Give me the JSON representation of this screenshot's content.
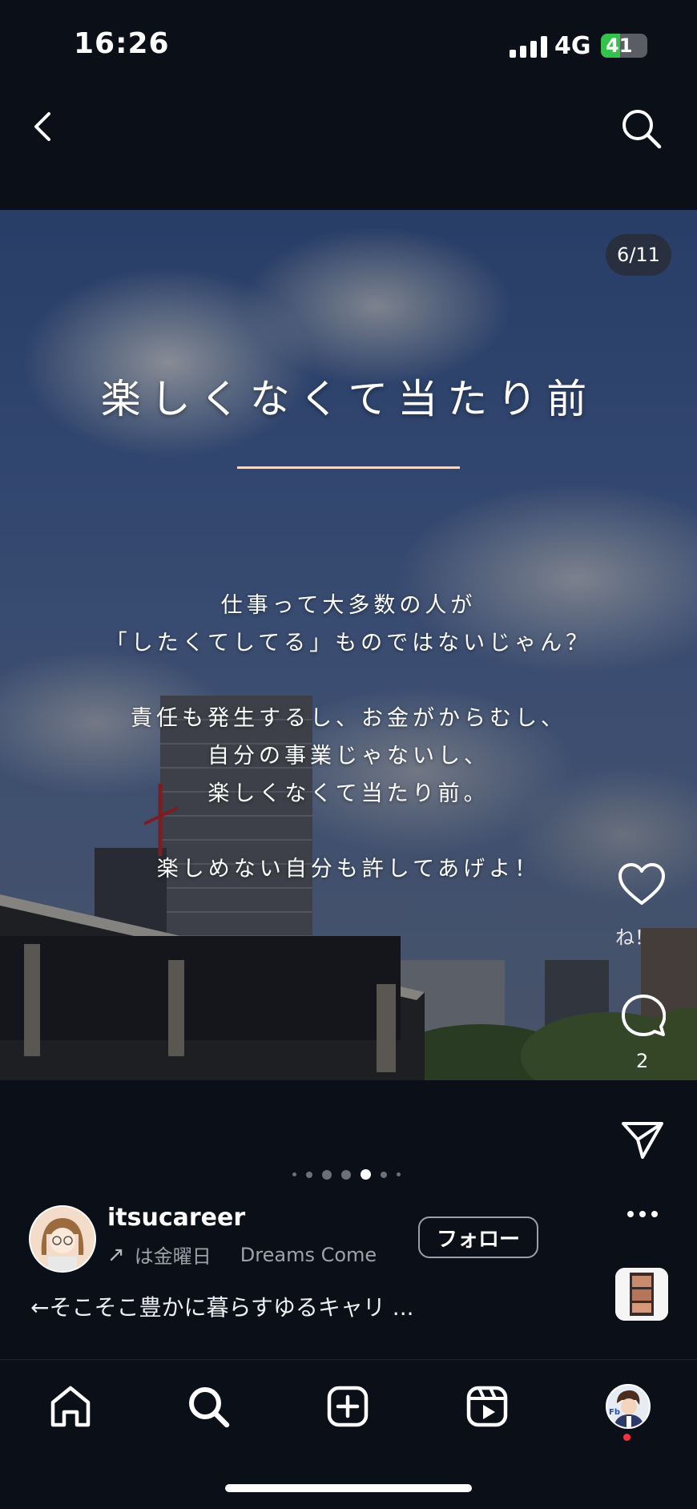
{
  "status_bar": {
    "time": "16:26",
    "network": "4G",
    "battery": "41",
    "battery_level": 0.41
  },
  "post": {
    "counter": "6/11",
    "headline": "楽しくなくて当たり前",
    "body_lines": [
      "仕事って大多数の人が",
      "「したくてしてる」ものではないじゃん？",
      "",
      "責任も発生するし、お金がからむし、",
      "自分の事業じゃないし、",
      "楽しくなくて当たり前。",
      "",
      "楽しめない自分も許してあげよ！"
    ]
  },
  "actions": {
    "like_label": "ね！",
    "comment_count": "2"
  },
  "carousel": {
    "active_index": 3
  },
  "author": {
    "username": "itsucareer",
    "music_prefix": "は金曜日",
    "music_title": "Dreams Come",
    "follow_label": "フォロー",
    "caption": "←そこそこ豊かに暮らすゆるキャリ ..."
  },
  "icons": {
    "back": "chevron-left-icon",
    "search": "search-icon",
    "like": "heart-icon",
    "comment": "comment-icon",
    "share": "send-icon",
    "more": "more-icon",
    "home": "home-icon",
    "create": "plus-square-icon",
    "reels": "reels-icon"
  },
  "colors": {
    "background": "#0b0f17",
    "battery_green": "#33c24a",
    "notification": "#ff2d3d"
  }
}
